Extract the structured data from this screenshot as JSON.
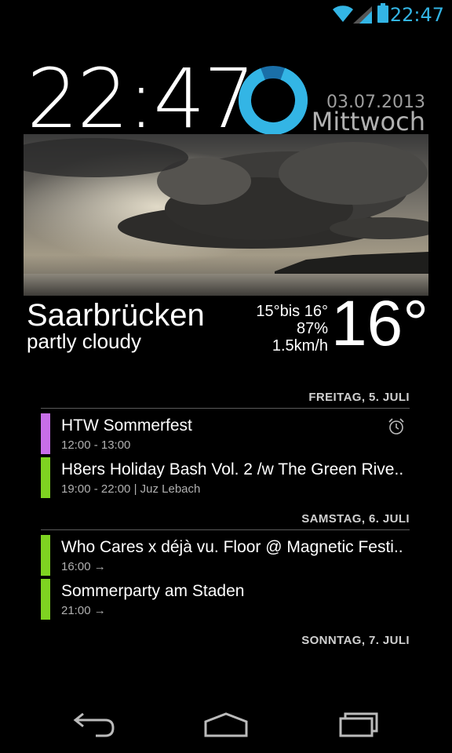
{
  "status": {
    "time": "22:47"
  },
  "clock": {
    "time": "22:47",
    "date": "03.07.2013",
    "weekday": "Mittwoch"
  },
  "weather": {
    "city": "Saarbrücken",
    "condition": "partly cloudy",
    "range": "15°bis 16°",
    "humidity": "87%",
    "wind": "1.5km/h",
    "temperature": "16°"
  },
  "agenda": [
    {
      "header": "FREITAG, 5. JULI",
      "events": [
        {
          "title": "HTW Sommerfest",
          "time": "12:00 - 13:00",
          "color": "#c76ee8",
          "alarm": true
        },
        {
          "title": "H8ers Holiday Bash Vol. 2 /w The Green Rive..",
          "time": "19:00 - 22:00  |  Juz Lebach",
          "color": "#7ed321",
          "alarm": false
        }
      ]
    },
    {
      "header": "SAMSTAG, 6. JULI",
      "events": [
        {
          "title": "Who Cares x déjà vu. Floor @ Magnetic Festi..",
          "time": "16:00 →",
          "color": "#7ed321",
          "alarm": false
        },
        {
          "title": "Sommerparty am Staden",
          "time": "21:00 →",
          "color": "#7ed321",
          "alarm": false
        }
      ]
    },
    {
      "header": "SONNTAG, 7. JULI",
      "events": []
    }
  ],
  "colors": {
    "accent": "#33b5e5",
    "purple": "#c76ee8",
    "green": "#7ed321"
  },
  "nav": {
    "back": "back-icon",
    "home": "home-icon",
    "recents": "recents-icon"
  }
}
